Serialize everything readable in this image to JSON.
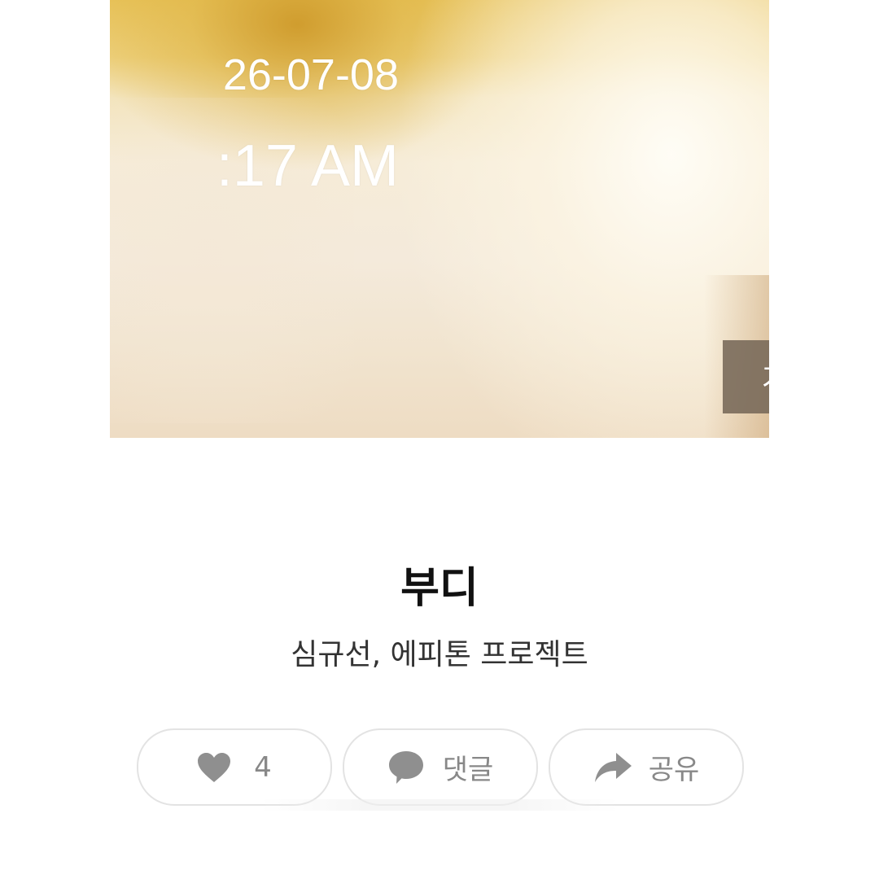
{
  "overlay": {
    "date": "26-07-08",
    "time": ":17 AM"
  },
  "album": {
    "lyrics_label": "가사"
  },
  "song": {
    "title": "부디",
    "artists": "심규선, 에피톤 프로젝트"
  },
  "actions": {
    "like_count": "4",
    "comment_label": "댓글",
    "share_label": "공유"
  },
  "icons": {
    "like": "heart-icon",
    "comment": "speech-bubble-icon",
    "share": "share-arrow-icon"
  },
  "colors": {
    "lyrics_button_bg": "#766858",
    "action_text": "#888888",
    "action_border": "#e3e3e3"
  }
}
